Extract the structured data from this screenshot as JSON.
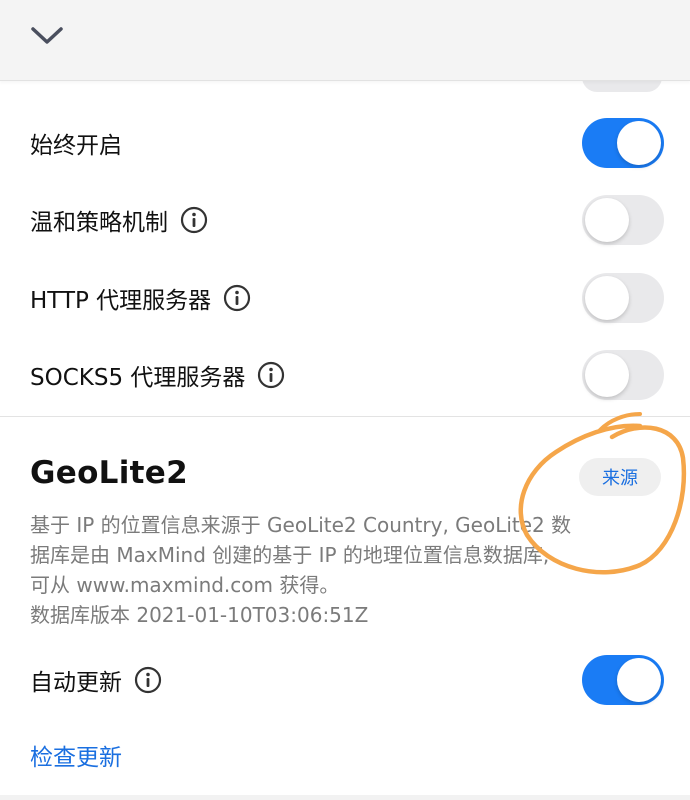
{
  "header": {
    "collapse_icon": "chevron-down-icon"
  },
  "settings": [
    {
      "label": "始终开启",
      "info": false,
      "enabled": true
    },
    {
      "label": "温和策略机制",
      "info": true,
      "enabled": false
    },
    {
      "label": "HTTP 代理服务器",
      "info": true,
      "enabled": false
    },
    {
      "label": "SOCKS5 代理服务器",
      "info": true,
      "enabled": false
    }
  ],
  "geolite": {
    "title": "GeoLite2",
    "source_button": "来源",
    "description_lines": [
      "基于 IP 的位置信息来源于 GeoLite2 Country, GeoLite2 数",
      "据库是由 MaxMind 创建的基于 IP 的地理位置信息数据库,",
      "可从 www.maxmind.com 获得。"
    ],
    "db_version": "数据库版本 2021-01-10T03:06:51Z",
    "auto_update": {
      "label": "自动更新",
      "info": true,
      "enabled": true
    },
    "check_update": "检查更新"
  },
  "colors": {
    "accent": "#1a7cf5",
    "link": "#1a6fe0",
    "toggle_off": "#e9e9eb",
    "annotation": "#f5a64a"
  }
}
